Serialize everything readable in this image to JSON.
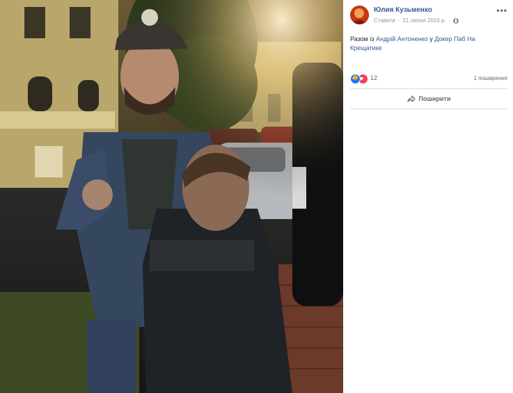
{
  "post": {
    "author": "Юлия Кузьменко",
    "edit_label": "Ставити",
    "date": "21 липня 2016 р.",
    "text_prefix": "Разом із ",
    "tagged_person": "Андрій Антоненко",
    "text_middle": " у ",
    "place": "Докер Паб На Крещатике",
    "reaction_count": "12",
    "shares": "1 поширення",
    "share_label": "Поширити",
    "more_label": "•••"
  },
  "icons": {
    "avatar": "profile-avatar",
    "globe": "globe-icon",
    "like": "like-icon",
    "love": "love-icon",
    "share": "share-icon",
    "more": "more-icon"
  },
  "colors": {
    "link_blue": "#385898",
    "like_blue": "#2078f4",
    "love_red": "#f33e58",
    "meta_gray": "#90949c"
  }
}
